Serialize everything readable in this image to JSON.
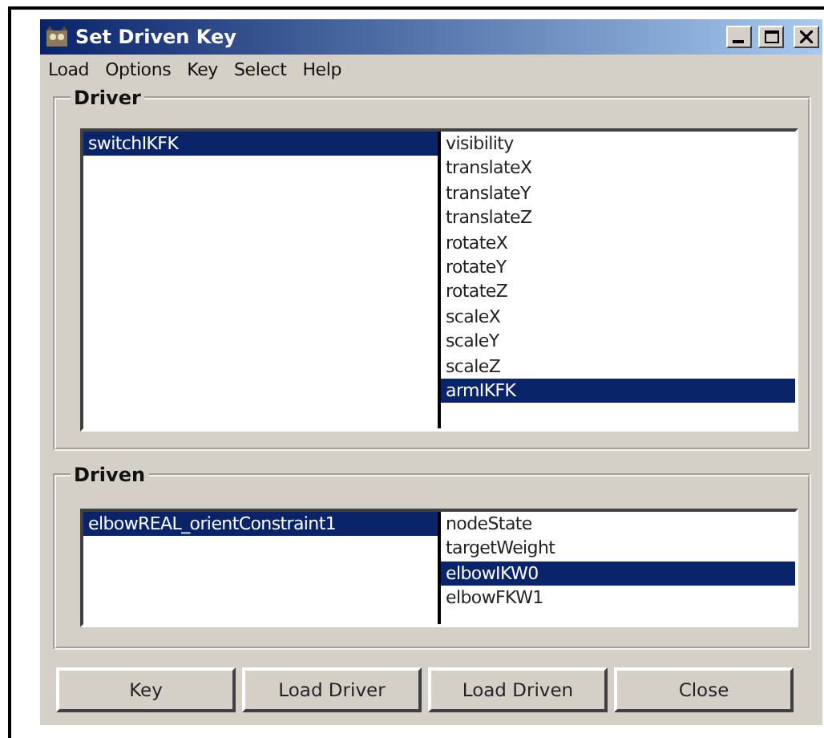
{
  "window": {
    "title": "Set Driven Key"
  },
  "menu": [
    "Load",
    "Options",
    "Key",
    "Select",
    "Help"
  ],
  "driver": {
    "label": "Driver",
    "objects": [
      {
        "name": "switchIKFK",
        "selected": true
      }
    ],
    "attributes": [
      {
        "name": "visibility",
        "selected": false
      },
      {
        "name": "translateX",
        "selected": false
      },
      {
        "name": "translateY",
        "selected": false
      },
      {
        "name": "translateZ",
        "selected": false
      },
      {
        "name": "rotateX",
        "selected": false
      },
      {
        "name": "rotateY",
        "selected": false
      },
      {
        "name": "rotateZ",
        "selected": false
      },
      {
        "name": "scaleX",
        "selected": false
      },
      {
        "name": "scaleY",
        "selected": false
      },
      {
        "name": "scaleZ",
        "selected": false
      },
      {
        "name": "armIKFK",
        "selected": true
      }
    ]
  },
  "driven": {
    "label": "Driven",
    "objects": [
      {
        "name": "elbowREAL_orientConstraint1",
        "selected": true
      }
    ],
    "attributes": [
      {
        "name": "nodeState",
        "selected": false
      },
      {
        "name": "targetWeight",
        "selected": false
      },
      {
        "name": "elbowIKW0",
        "selected": true
      },
      {
        "name": "elbowFKW1",
        "selected": false
      }
    ]
  },
  "buttons": [
    "Key",
    "Load Driver",
    "Load Driven",
    "Close"
  ]
}
